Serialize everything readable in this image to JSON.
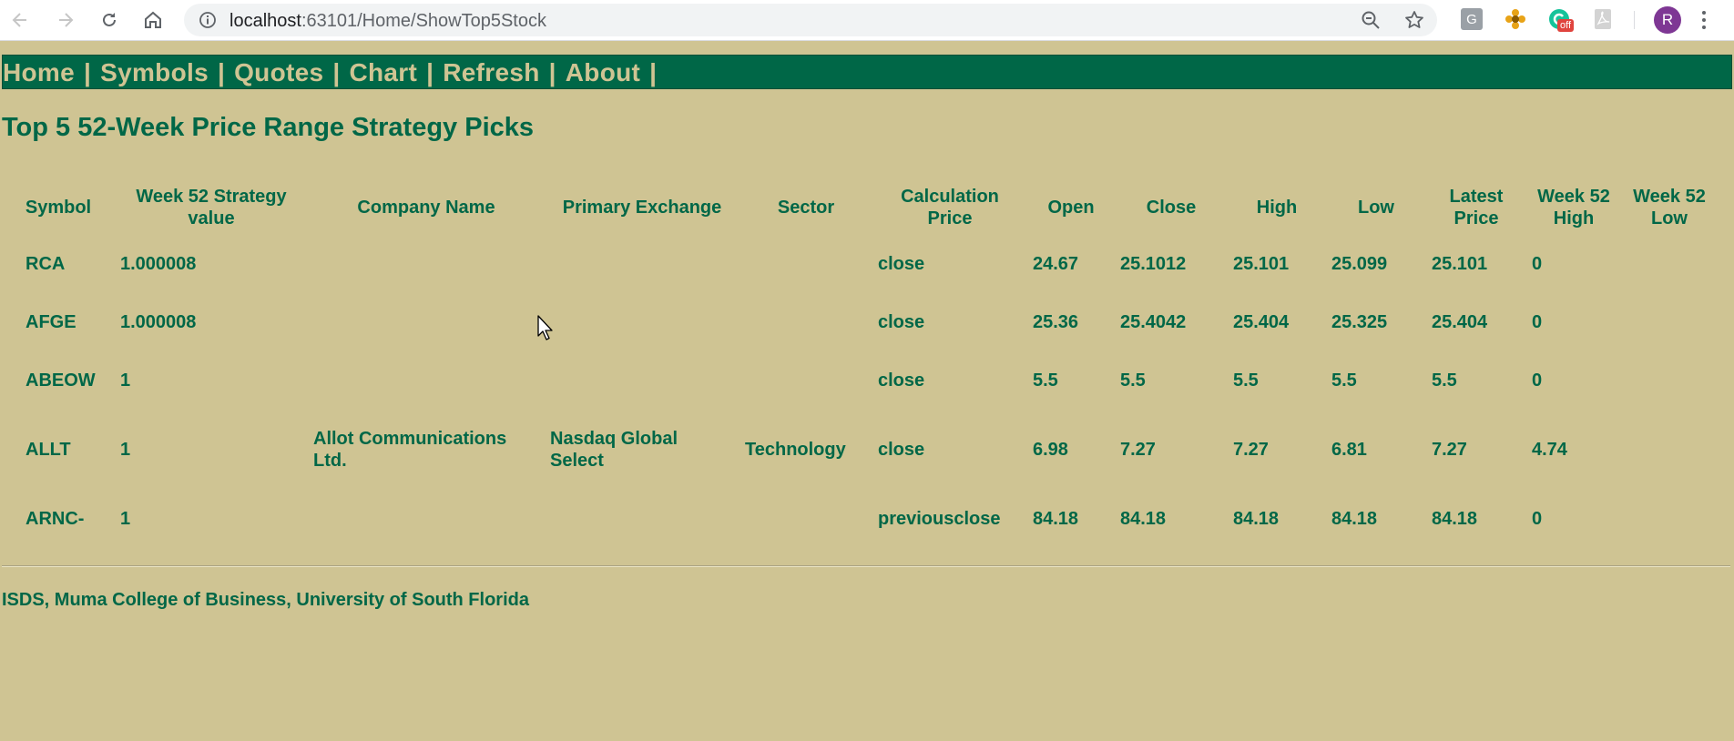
{
  "browser": {
    "url_host": "localhost",
    "url_path": ":63101/Home/ShowTop5Stock",
    "avatar_letter": "R",
    "extension_badge": "off"
  },
  "nav": {
    "items": [
      "Home",
      "Symbols",
      "Quotes",
      "Chart",
      "Refresh",
      "About"
    ],
    "separator": "|"
  },
  "page_title": "Top 5 52-Week Price Range Strategy Picks",
  "table": {
    "headers": {
      "symbol": "Symbol",
      "strategy": "Week 52 Strategy value",
      "company": "Company Name",
      "exchange": "Primary Exchange",
      "sector": "Sector",
      "calc_price": "Calculation Price",
      "open": "Open",
      "close": "Close",
      "high": "High",
      "low": "Low",
      "latest": "Latest Price",
      "w52high": "Week 52 High",
      "w52low": "Week 52 Low"
    },
    "rows": [
      {
        "symbol": "RCA",
        "strategy": "1.000008",
        "company": "",
        "exchange": "",
        "sector": "",
        "calc_price": "close",
        "open": "24.67",
        "close": "25.1012",
        "high": "25.101",
        "low": "25.099",
        "latest": "25.101",
        "w52high": "0",
        "w52low": ""
      },
      {
        "symbol": "AFGE",
        "strategy": "1.000008",
        "company": "",
        "exchange": "",
        "sector": "",
        "calc_price": "close",
        "open": "25.36",
        "close": "25.4042",
        "high": "25.404",
        "low": "25.325",
        "latest": "25.404",
        "w52high": "0",
        "w52low": ""
      },
      {
        "symbol": "ABEOW",
        "strategy": "1",
        "company": "",
        "exchange": "",
        "sector": "",
        "calc_price": "close",
        "open": "5.5",
        "close": "5.5",
        "high": "5.5",
        "low": "5.5",
        "latest": "5.5",
        "w52high": "0",
        "w52low": ""
      },
      {
        "symbol": "ALLT",
        "strategy": "1",
        "company": "Allot Communications Ltd.",
        "exchange": "Nasdaq Global Select",
        "sector": "Technology",
        "calc_price": "close",
        "open": "6.98",
        "close": "7.27",
        "high": "7.27",
        "low": "6.81",
        "latest": "7.27",
        "w52high": "4.74",
        "w52low": ""
      },
      {
        "symbol": "ARNC-",
        "strategy": "1",
        "company": "",
        "exchange": "",
        "sector": "",
        "calc_price": "previousclose",
        "open": "84.18",
        "close": "84.18",
        "high": "84.18",
        "low": "84.18",
        "latest": "84.18",
        "w52high": "0",
        "w52low": ""
      }
    ]
  },
  "footer": "ISDS, Muma College of Business, University of South Florida",
  "colors": {
    "page_bg": "#cfc493",
    "brand_green": "#006747",
    "nav_text": "#cfc493"
  }
}
